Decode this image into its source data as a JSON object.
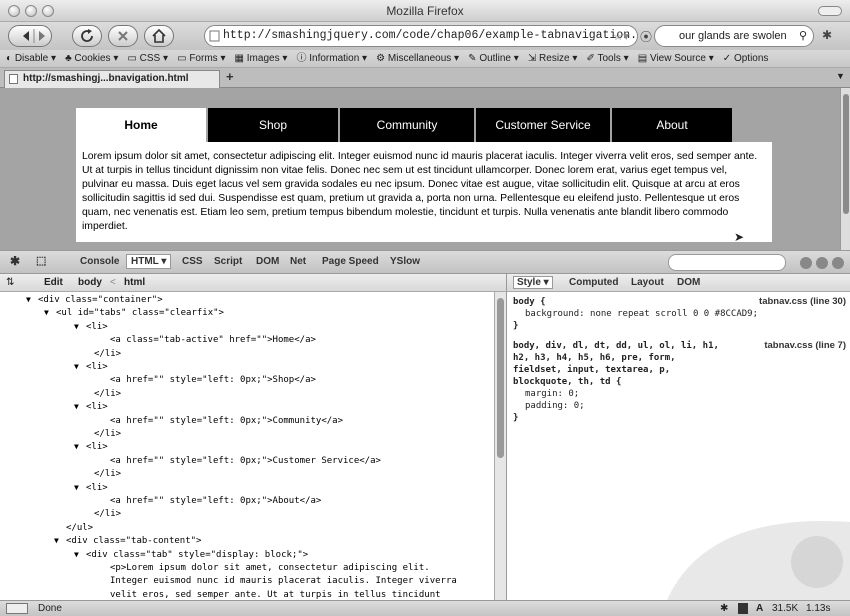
{
  "window": {
    "title": "Mozilla Firefox"
  },
  "navbar": {
    "url": "http://smashingjquery.com/code/chap06/example-tabnavigation.html",
    "search_value": "our glands are swolen"
  },
  "webdev_toolbar": {
    "items": [
      "Disable",
      "Cookies",
      "CSS",
      "Forms",
      "Images",
      "Information",
      "Miscellaneous",
      "Outline",
      "Resize",
      "Tools",
      "View Source",
      "Options"
    ]
  },
  "browser_tab": {
    "label": "http://smashingj...bnavigation.html",
    "new_tab": "+"
  },
  "page": {
    "tabs": [
      "Home",
      "Shop",
      "Community",
      "Customer Service",
      "About"
    ],
    "active_tab": "Home",
    "content": "Lorem ipsum dolor sit amet, consectetur adipiscing elit. Integer euismod nunc id mauris placerat iaculis. Integer viverra velit eros, sed semper ante. Ut at turpis in tellus tincidunt dignissim non vitae felis. Donec nec sem ut est tincidunt ullamcorper. Donec lorem erat, varius eget tempus vel, pulvinar eu massa. Duis eget lacus vel sem gravida sodales eu nec ipsum. Donec vitae est augue, vitae sollicitudin elit. Quisque at arcu at eros sollicitudin sagittis id sed dui. Suspendisse est quam, pretium ut gravida a, porta non urna. Pellentesque eu eleifend justo. Pellentesque ut eros quam, nec venenatis est. Etiam leo sem, pretium tempus bibendum molestie, tincidunt et turpis. Nulla venenatis ante blandit libero commodo imperdiet."
  },
  "firebug": {
    "panels": [
      "Console",
      "HTML",
      "CSS",
      "Script",
      "DOM",
      "Net",
      "Page Speed",
      "YSlow"
    ],
    "active_panel": "HTML",
    "breadcrumb": {
      "edit": "Edit",
      "path": [
        "body",
        "html"
      ],
      "separator": "<"
    },
    "side_tabs": [
      "Style",
      "Computed",
      "Layout",
      "DOM"
    ],
    "active_side_tab": "Style",
    "html_lines": [
      {
        "text": "<div class=\"container\">"
      },
      {
        "text": "<ul id=\"tabs\" class=\"clearfix\">"
      },
      {
        "text": "<li>"
      },
      {
        "text": "<a class=\"tab-active\" href=\"\">Home</a>"
      },
      {
        "text": "</li>"
      },
      {
        "text": "<li>"
      },
      {
        "text": "<a href=\"\" style=\"left: 0px;\">Shop</a>"
      },
      {
        "text": "</li>"
      },
      {
        "text": "<li>"
      },
      {
        "text": "<a href=\"\" style=\"left: 0px;\">Community</a>"
      },
      {
        "text": "</li>"
      },
      {
        "text": "<li>"
      },
      {
        "text": "<a href=\"\" style=\"left: 0px;\">Customer Service</a>"
      },
      {
        "text": "</li>"
      },
      {
        "text": "<li>"
      },
      {
        "text": "<a href=\"\" style=\"left: 0px;\">About</a>"
      },
      {
        "text": "</li>"
      },
      {
        "text": "</ul>"
      },
      {
        "text": "<div class=\"tab-content\">"
      },
      {
        "text": "<div class=\"tab\" style=\"display: block;\">"
      },
      {
        "text": "<p>Lorem ipsum dolor sit amet, consectetur adipiscing elit."
      },
      {
        "text": "Integer euismod nunc id mauris placerat iaculis. Integer viverra"
      },
      {
        "text": "velit eros, sed semper ante. Ut at turpis in tellus tincidunt"
      }
    ],
    "style_rules": [
      {
        "source": "tabnav.css (line 30)",
        "lines": [
          "body {",
          "background: none repeat scroll 0 0 #8CCAD9;",
          "}"
        ]
      },
      {
        "source": "tabnav.css (line 7)",
        "lines": [
          "body, div, dl, dt, dd, ul, ol, li, h1,",
          "h2, h3, h4, h5, h6, pre, form,",
          "fieldset, input, textarea, p,",
          "blockquote, th, td {",
          "margin: 0;",
          "padding: 0;",
          "}"
        ]
      }
    ]
  },
  "status": {
    "text": "Done",
    "size": "31.5K",
    "time": "1.13s",
    "letter": "A"
  }
}
